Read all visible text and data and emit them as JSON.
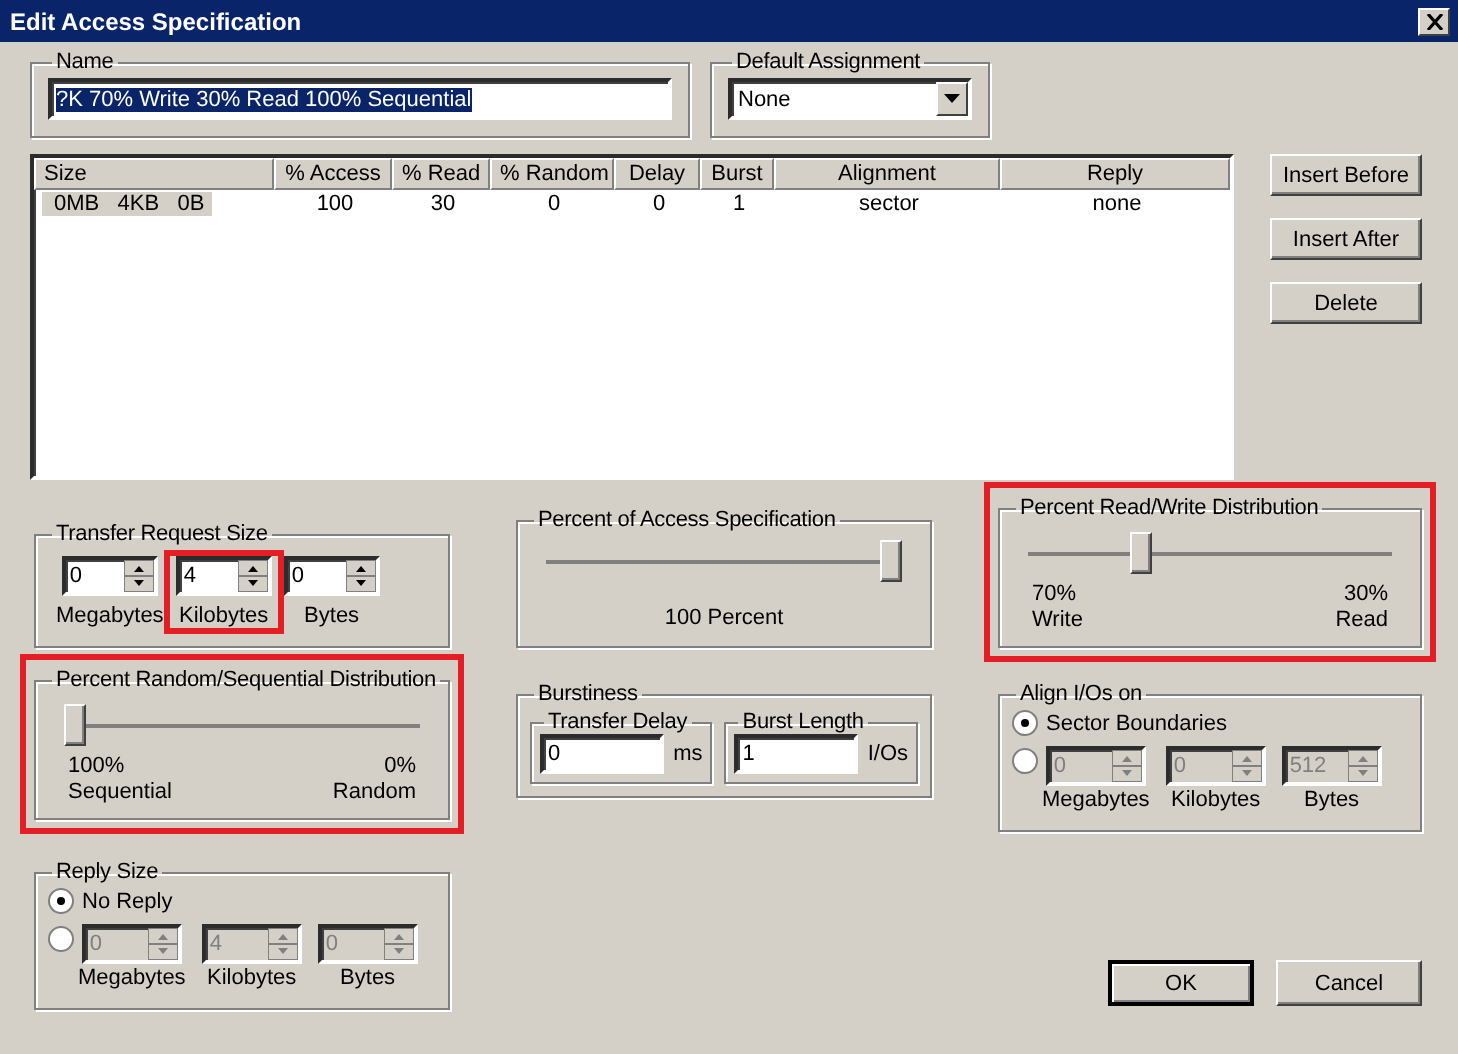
{
  "window": {
    "title": "Edit Access Specification"
  },
  "name": {
    "label": "Name",
    "value": "?K 70% Write 30% Read 100% Sequential",
    "text_selected": true
  },
  "default_assignment": {
    "label": "Default Assignment",
    "value": "None"
  },
  "table": {
    "columns": [
      "Size",
      "% Access",
      "% Read",
      "% Random",
      "Delay",
      "Burst",
      "Alignment",
      "Reply"
    ],
    "rows": [
      {
        "cells": [
          "0MB   4KB   0B",
          "100",
          "30",
          "0",
          "0",
          "1",
          "sector",
          "none"
        ],
        "selected": true
      }
    ]
  },
  "list_buttons": [
    "Insert Before",
    "Insert After",
    "Delete"
  ],
  "transfer_request_size": {
    "title": "Transfer Request Size",
    "spinners": [
      {
        "value": "0",
        "label": "Megabytes",
        "disabled": false
      },
      {
        "value": "4",
        "label": "Kilobytes",
        "disabled": false,
        "highlighted": true
      },
      {
        "value": "0",
        "label": "Bytes",
        "disabled": false
      }
    ]
  },
  "percent_of_access": {
    "title": "Percent of Access Specification",
    "level": 1,
    "reading": "100 Percent"
  },
  "read_write": {
    "title": "Percent Read/Write Distribution",
    "highlighted": true,
    "level": 0.3,
    "left": {
      "value": "70%",
      "label": "Write"
    },
    "right": {
      "value": "30%",
      "label": "Read"
    }
  },
  "random_sequential": {
    "title": "Percent Random/Sequential Distribution",
    "highlighted": true,
    "level": 0,
    "left": {
      "value": "100%",
      "label": "Sequential"
    },
    "right": {
      "value": "0%",
      "label": "Random"
    }
  },
  "burstiness": {
    "title": "Burstiness",
    "fields": [
      {
        "title": "Transfer Delay",
        "value": "0",
        "unit": "ms"
      },
      {
        "title": "Burst Length",
        "value": "1",
        "unit": "I/Os"
      }
    ]
  },
  "align": {
    "title": "Align I/Os on",
    "options": [
      {
        "kind": "label",
        "label": "Sector Boundaries",
        "selected": true
      },
      {
        "kind": "spinners",
        "selected": false,
        "spinners": [
          {
            "value": "0",
            "label": "Megabytes",
            "disabled": true
          },
          {
            "value": "0",
            "label": "Kilobytes",
            "disabled": true
          },
          {
            "value": "512",
            "label": "Bytes",
            "disabled": true
          }
        ]
      }
    ]
  },
  "reply_size": {
    "title": "Reply Size",
    "options": [
      {
        "kind": "label",
        "label": "No Reply",
        "selected": true
      },
      {
        "kind": "spinners",
        "selected": false,
        "spinners": [
          {
            "value": "0",
            "label": "Megabytes",
            "disabled": true
          },
          {
            "value": "4",
            "label": "Kilobytes",
            "disabled": true
          },
          {
            "value": "0",
            "label": "Bytes",
            "disabled": true
          }
        ]
      }
    ]
  },
  "buttons": [
    {
      "label": "OK",
      "default": true
    },
    {
      "label": "Cancel",
      "default": false
    }
  ]
}
